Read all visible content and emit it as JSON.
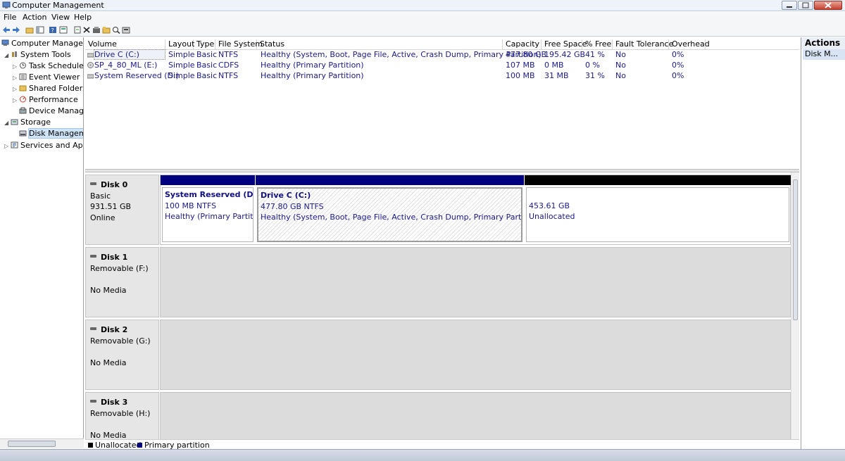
{
  "window": {
    "title": "Computer Management"
  },
  "menu": [
    "File",
    "Action",
    "View",
    "Help"
  ],
  "tree": {
    "root": "Computer Manageme",
    "system_tools": "System Tools",
    "task_scheduler": "Task Scheduler",
    "event_viewer": "Event Viewer",
    "shared_folders": "Shared Folders",
    "performance": "Performance",
    "device_manager": "Device Manager",
    "storage": "Storage",
    "disk_management": "Disk Manageme",
    "services": "Services and Applic"
  },
  "volume_list": {
    "columns": [
      "Volume",
      "Layout",
      "Type",
      "File System",
      "Status",
      "Capacity",
      "Free Space",
      "% Free",
      "Fault Tolerance",
      "Overhead"
    ],
    "rows": [
      {
        "volume": "Drive C (C:)",
        "layout": "Simple",
        "type": "Basic",
        "fs": "NTFS",
        "status": "Healthy (System, Boot, Page File, Active, Crash Dump, Primary Partition)",
        "capacity": "477.80 GB",
        "free": "195.42 GB",
        "pct": "41 %",
        "fault": "No",
        "overhead": "0%"
      },
      {
        "volume": "SP_4_80_ML (E:)",
        "layout": "Simple",
        "type": "Basic",
        "fs": "CDFS",
        "status": "Healthy (Primary Partition)",
        "capacity": "107 MB",
        "free": "0 MB",
        "pct": "0 %",
        "fault": "No",
        "overhead": "0%"
      },
      {
        "volume": "System Reserved (D:)",
        "layout": "Simple",
        "type": "Basic",
        "fs": "NTFS",
        "status": "Healthy (Primary Partition)",
        "capacity": "100 MB",
        "free": "31 MB",
        "pct": "31 %",
        "fault": "No",
        "overhead": "0%"
      }
    ]
  },
  "disks": [
    {
      "name": "Disk 0",
      "line1": "Basic",
      "line2": "931.51 GB",
      "line3": "Online"
    },
    {
      "name": "Disk 1",
      "line1": "Removable (F:)",
      "line2": "",
      "line3": "No Media"
    },
    {
      "name": "Disk 2",
      "line1": "Removable (G:)",
      "line2": "",
      "line3": "No Media"
    },
    {
      "name": "Disk 3",
      "line1": "Removable (H:)",
      "line2": "",
      "line3": "No Media"
    }
  ],
  "partitions": [
    {
      "name": "System Reserved  (D:)",
      "size": "100 MB NTFS",
      "status": "Healthy (Primary Partition)",
      "bar_color": "#00007f"
    },
    {
      "name": "Drive C  (C:)",
      "size": "477.80 GB NTFS",
      "status": "Healthy (System, Boot, Page File, Active, Crash Dump, Primary Partition)",
      "bar_color": "#00007f"
    },
    {
      "name": "",
      "size": "453.61 GB",
      "status": "Unallocated",
      "bar_color": "#000000"
    }
  ],
  "legend": {
    "unallocated": "Unallocated",
    "primary": "Primary partition",
    "unallocated_color": "#000000",
    "primary_color": "#00007f"
  },
  "actions": {
    "header": "Actions",
    "item": "Disk M..."
  }
}
